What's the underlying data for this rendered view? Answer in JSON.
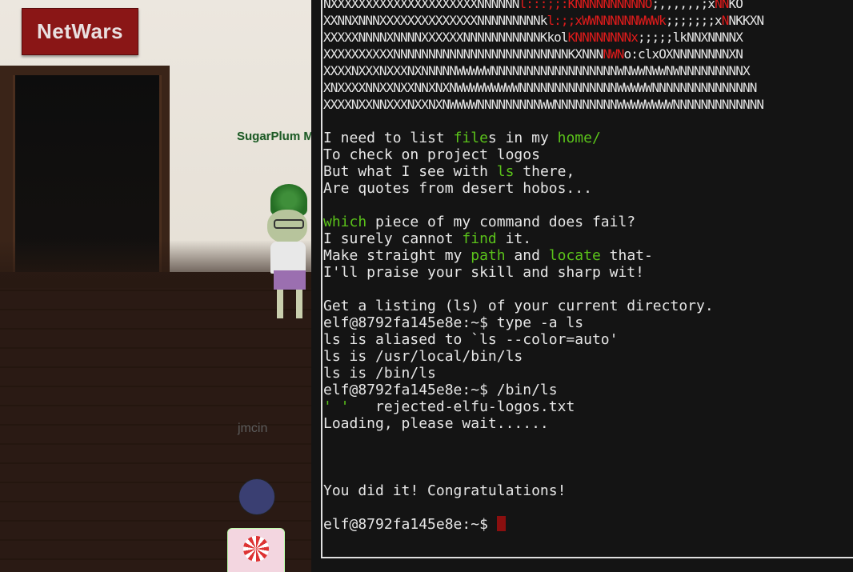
{
  "scene": {
    "sign_text": "NetWars",
    "player_names": [
      "SugarPlum M",
      "jmcin"
    ]
  },
  "terminal": {
    "banner_lines": [
      [
        {
          "t": "NXXXXXXXXXXXXXXXXXXXXXNNNNNN"
        },
        {
          "t": "l:::;;:KNNNNNNNNNNO",
          "c": "r"
        },
        {
          "t": ";,,,,,,;x"
        },
        {
          "t": "NN",
          "c": "r"
        },
        {
          "t": "KO"
        }
      ],
      [
        {
          "t": "XXNNXNNNXXXXXXXXXXXXXXNNNNNNNNNk"
        },
        {
          "t": "l:;;xWWNNNNNNWWWk",
          "c": "r"
        },
        {
          "t": ";;;;;;;x"
        },
        {
          "t": "N",
          "c": "r"
        },
        {
          "t": "NKKXN"
        }
      ],
      [
        {
          "t": "XXXXXNNNNXNNNNXXXXXXNNNNNNNNNNNKkol"
        },
        {
          "t": "KNNNNNNNNx",
          "c": "r"
        },
        {
          "t": ";;;;;lkNNXNNNNX"
        }
      ],
      [
        {
          "t": "XXXXXXXXXXNNNNNNNNNNNNNNNNNNNNNNNNNKXNNN"
        },
        {
          "t": "NWN",
          "c": "r"
        },
        {
          "t": "o:clxOXNNNNNNNNXN"
        }
      ],
      [
        {
          "t": "XXXXNXXXNXXXNXNNNNNWWWWWNNNNNNNNNNNNNNNNNNWNWWNWWNWNNNNNNNNNX"
        }
      ],
      [
        {
          "t": "XNXXXXNNXXNXXNNXNXNWWWWWWWWWNNNNNNNNNNNNNNWWWWWNNNNNNNNNNNNNNN"
        }
      ],
      [
        {
          "t": "XXXXNXXNNXXXNXXNXNWWWWNNNNNNNNNWWNNNNNNNNNWWWWWWWWNNNNNNNNNNNNN"
        }
      ]
    ],
    "lines": [
      [],
      [
        {
          "t": "I need to list "
        },
        {
          "t": "file",
          "c": "g"
        },
        {
          "t": "s in my "
        },
        {
          "t": "home/",
          "c": "g"
        }
      ],
      [
        {
          "t": "To check on project logos"
        }
      ],
      [
        {
          "t": "But what I see with "
        },
        {
          "t": "ls",
          "c": "g"
        },
        {
          "t": " there,"
        }
      ],
      [
        {
          "t": "Are quotes from desert hobos..."
        }
      ],
      [],
      [
        {
          "t": "which",
          "c": "g"
        },
        {
          "t": " piece of my command does fail?"
        }
      ],
      [
        {
          "t": "I surely cannot "
        },
        {
          "t": "find",
          "c": "g"
        },
        {
          "t": " it."
        }
      ],
      [
        {
          "t": "Make straight my "
        },
        {
          "t": "path",
          "c": "g"
        },
        {
          "t": " and "
        },
        {
          "t": "locate",
          "c": "g"
        },
        {
          "t": " that-"
        }
      ],
      [
        {
          "t": "I'll praise your skill and sharp wit!"
        }
      ],
      [],
      [
        {
          "t": "Get a listing (ls) of your current directory."
        }
      ],
      [
        {
          "t": "elf@8792fa145e8e:~$ type -a ls"
        }
      ],
      [
        {
          "t": "ls is aliased to `ls --color=auto'"
        }
      ],
      [
        {
          "t": "ls is /usr/local/bin/ls"
        }
      ],
      [
        {
          "t": "ls is /bin/ls"
        }
      ],
      [
        {
          "t": "elf@8792fa145e8e:~$ /bin/ls"
        }
      ],
      [
        {
          "t": "' '",
          "c": "g"
        },
        {
          "t": "   rejected-elfu-logos.txt"
        }
      ],
      [
        {
          "t": "Loading, please wait......"
        }
      ],
      [],
      [],
      [],
      [
        {
          "t": "You did it! Congratulations!"
        }
      ],
      []
    ],
    "prompt": "elf@8792fa145e8e:~$ "
  },
  "colors": {
    "terminal_bg": "#141414",
    "terminal_text": "#e6e6e6",
    "highlight_green": "#5ac21a",
    "highlight_red": "#e01b1b",
    "sign_bg": "#8a1616",
    "cursor": "#8a0f0f"
  }
}
